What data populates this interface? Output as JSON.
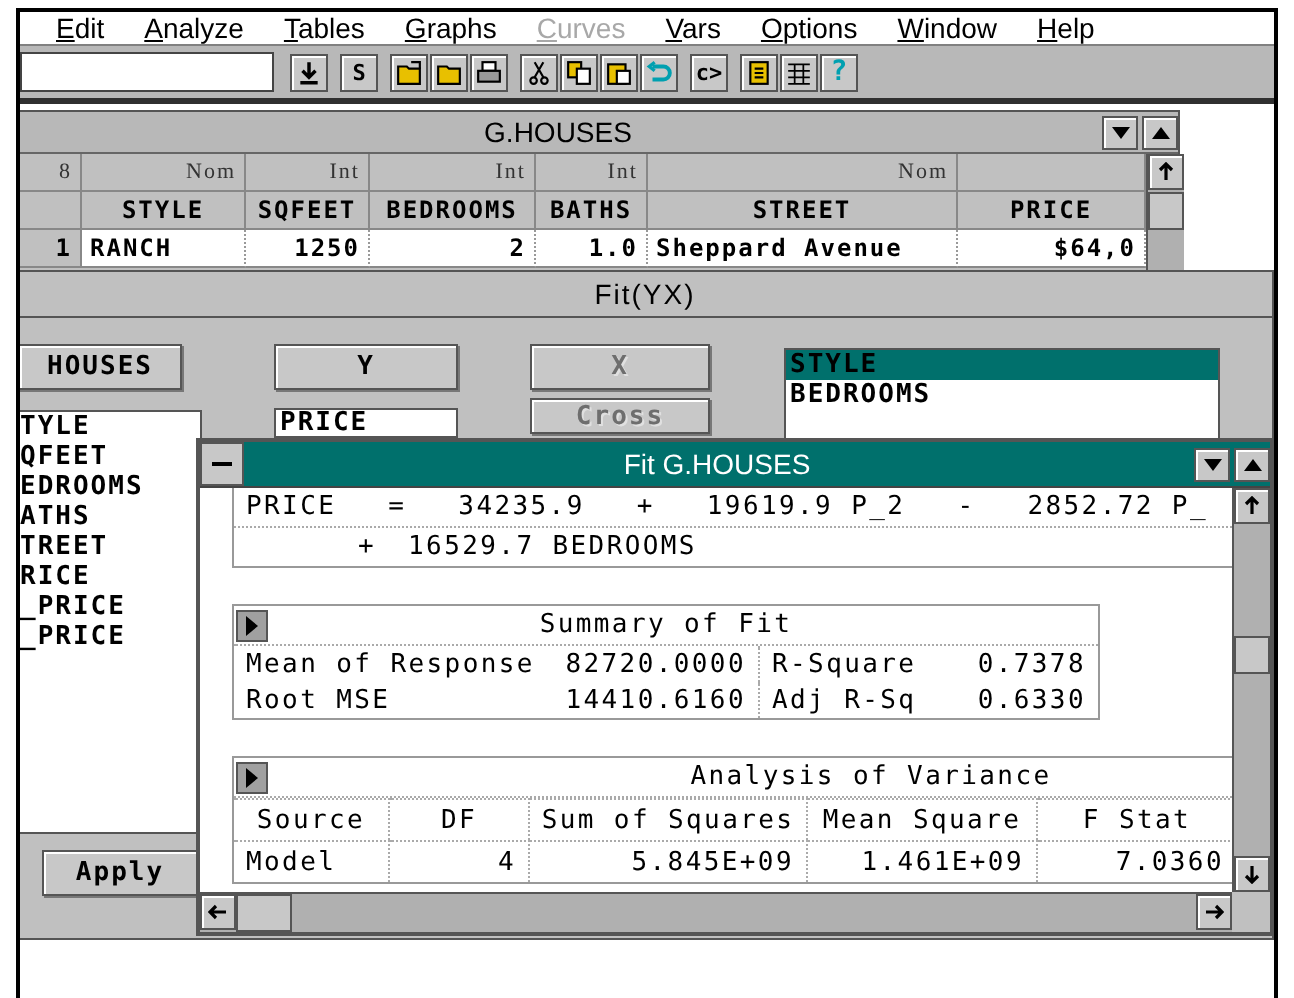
{
  "menu_bar": [
    {
      "label": "Edit",
      "disabled": false
    },
    {
      "label": "Analyze",
      "disabled": false
    },
    {
      "label": "Tables",
      "disabled": false
    },
    {
      "label": "Graphs",
      "disabled": false
    },
    {
      "label": "Curves",
      "disabled": true
    },
    {
      "label": "Vars",
      "disabled": false
    },
    {
      "label": "Options",
      "disabled": false
    },
    {
      "label": "Window",
      "disabled": false
    },
    {
      "label": "Help",
      "disabled": false
    }
  ],
  "toolbar": {
    "groups": [
      [
        {
          "kind": "download"
        }
      ],
      [
        {
          "kind": "text",
          "label": "S"
        }
      ],
      [
        {
          "kind": "open"
        },
        {
          "kind": "folder"
        },
        {
          "kind": "print"
        }
      ],
      [
        {
          "kind": "cut"
        },
        {
          "kind": "copy"
        },
        {
          "kind": "paste"
        },
        {
          "kind": "undo"
        }
      ],
      [
        {
          "kind": "text",
          "label": "c>"
        }
      ],
      [
        {
          "kind": "script"
        },
        {
          "kind": "grid"
        },
        {
          "kind": "help",
          "label": "?"
        }
      ]
    ]
  },
  "data_table": {
    "title": "G.HOUSES",
    "corner": "8",
    "columns": [
      {
        "name": "STYLE",
        "type": "Nom",
        "kind": "text"
      },
      {
        "name": "SQFEET",
        "type": "Int",
        "kind": "number"
      },
      {
        "name": "BEDROOMS",
        "type": "Int",
        "kind": "number"
      },
      {
        "name": "BATHS",
        "type": "Int",
        "kind": "number"
      },
      {
        "name": "STREET",
        "type": "Nom",
        "kind": "text"
      },
      {
        "name": "PRICE",
        "kind": "number"
      }
    ],
    "rows": [
      {
        "number": "1",
        "cells": [
          "RANCH",
          "1250",
          "2",
          "1.0",
          "Sheppard Avenue",
          "$64,0"
        ]
      }
    ]
  },
  "fit_dialog": {
    "title": "Fit(YX)",
    "table_button": {
      "label": "HOUSES",
      "disabled": false
    },
    "columns_list": [
      "TYLE",
      "QFEET",
      "EDROOMS",
      "ATHS",
      "TREET",
      "RICE",
      "_PRICE",
      "_PRICE"
    ],
    "y_button": {
      "label": "Y",
      "disabled": false
    },
    "y_field": {
      "value": "PRICE"
    },
    "x_button": {
      "label": "X",
      "disabled": true
    },
    "cross_button": {
      "label": "Cross",
      "disabled": true
    },
    "effects_list": [
      {
        "label": "STYLE",
        "selected": true
      },
      {
        "label": "BEDROOMS",
        "selected": false
      }
    ],
    "apply_button": {
      "label": "Apply",
      "disabled": false
    }
  },
  "fit_report": {
    "title": "Fit G.HOUSES",
    "equation": [
      [
        "PRICE",
        "=",
        "34235.9",
        "+",
        "19619.9 P_2",
        "-",
        "2852.72 P_"
      ],
      [
        "+",
        "16529.7 BEDROOMS"
      ]
    ],
    "summary": {
      "title": "Summary of Fit",
      "rows": [
        [
          "Mean of Response",
          "82720.0000",
          "R-Square",
          "0.7378"
        ],
        [
          "Root MSE",
          "14410.6160",
          "Adj R-Sq",
          "0.6330"
        ]
      ]
    },
    "anova": {
      "title": "Analysis of Variance",
      "columns": [
        "Source",
        "DF",
        "Sum of Squares",
        "Mean Square",
        "F Stat"
      ],
      "rows": [
        [
          "Model",
          "4",
          "5.845E+09",
          "1.461E+09",
          "7.0360"
        ]
      ]
    }
  }
}
